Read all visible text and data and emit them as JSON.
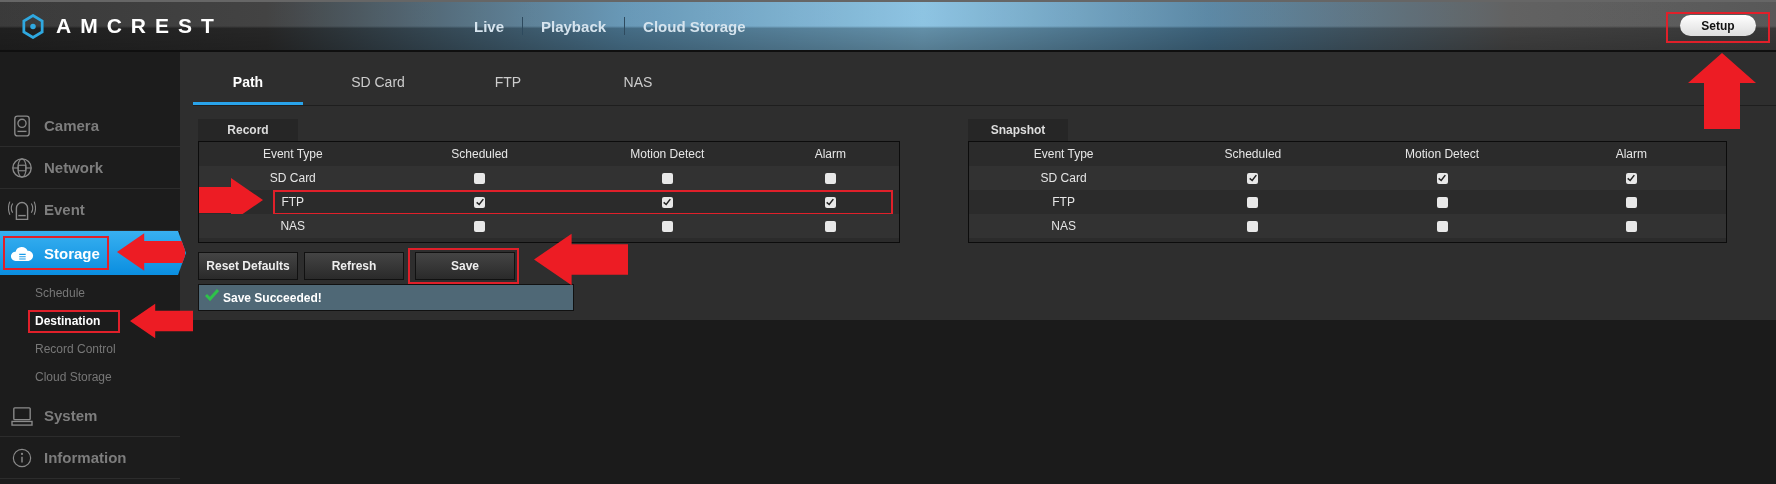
{
  "header": {
    "brand": "AMCREST",
    "nav": [
      {
        "label": "Live"
      },
      {
        "label": "Playback"
      },
      {
        "label": "Cloud Storage"
      }
    ],
    "setup_button": {
      "label": "Setup",
      "highlighted": true
    }
  },
  "sidebar": {
    "items": [
      {
        "label": "Camera",
        "selected": false,
        "highlighted": false
      },
      {
        "label": "Network",
        "selected": false,
        "highlighted": false
      },
      {
        "label": "Event",
        "selected": false,
        "highlighted": false
      },
      {
        "label": "Storage",
        "selected": true,
        "highlighted": true,
        "children": [
          {
            "label": "Schedule",
            "selected": false,
            "highlighted": false
          },
          {
            "label": "Destination",
            "selected": true,
            "highlighted": true
          },
          {
            "label": "Record Control",
            "selected": false,
            "highlighted": false
          },
          {
            "label": "Cloud Storage",
            "selected": false,
            "highlighted": false
          }
        ]
      },
      {
        "label": "System",
        "selected": false,
        "highlighted": false
      },
      {
        "label": "Information",
        "selected": false,
        "highlighted": false
      }
    ]
  },
  "tabs": [
    {
      "label": "Path",
      "selected": true
    },
    {
      "label": "SD Card",
      "selected": false
    },
    {
      "label": "FTP",
      "selected": false
    },
    {
      "label": "NAS",
      "selected": false
    }
  ],
  "record": {
    "title": "Record",
    "columns": [
      "Event Type",
      "Scheduled",
      "Motion Detect",
      "Alarm"
    ],
    "rows": [
      {
        "label": "SD Card",
        "highlighted": false,
        "cells": [
          {
            "checked": false
          },
          {
            "checked": false
          },
          {
            "checked": false
          }
        ]
      },
      {
        "label": "FTP",
        "highlighted": true,
        "cells": [
          {
            "checked": true
          },
          {
            "checked": true
          },
          {
            "checked": true
          }
        ]
      },
      {
        "label": "NAS",
        "highlighted": false,
        "cells": [
          {
            "checked": false
          },
          {
            "checked": false
          },
          {
            "checked": false
          }
        ]
      }
    ]
  },
  "snapshot": {
    "title": "Snapshot",
    "columns": [
      "Event Type",
      "Scheduled",
      "Motion Detect",
      "Alarm"
    ],
    "rows": [
      {
        "label": "SD Card",
        "highlighted": false,
        "cells": [
          {
            "checked": true
          },
          {
            "checked": true
          },
          {
            "checked": true
          }
        ]
      },
      {
        "label": "FTP",
        "highlighted": false,
        "cells": [
          {
            "checked": false
          },
          {
            "checked": false
          },
          {
            "checked": false
          }
        ]
      },
      {
        "label": "NAS",
        "highlighted": false,
        "cells": [
          {
            "checked": false
          },
          {
            "checked": false
          },
          {
            "checked": false
          }
        ]
      }
    ]
  },
  "buttons": [
    {
      "label": "Reset Defaults",
      "highlighted": false
    },
    {
      "label": "Refresh",
      "highlighted": false
    },
    {
      "label": "Save",
      "highlighted": true
    }
  ],
  "message": {
    "text": "Save Succeeded!",
    "kind": "success"
  }
}
